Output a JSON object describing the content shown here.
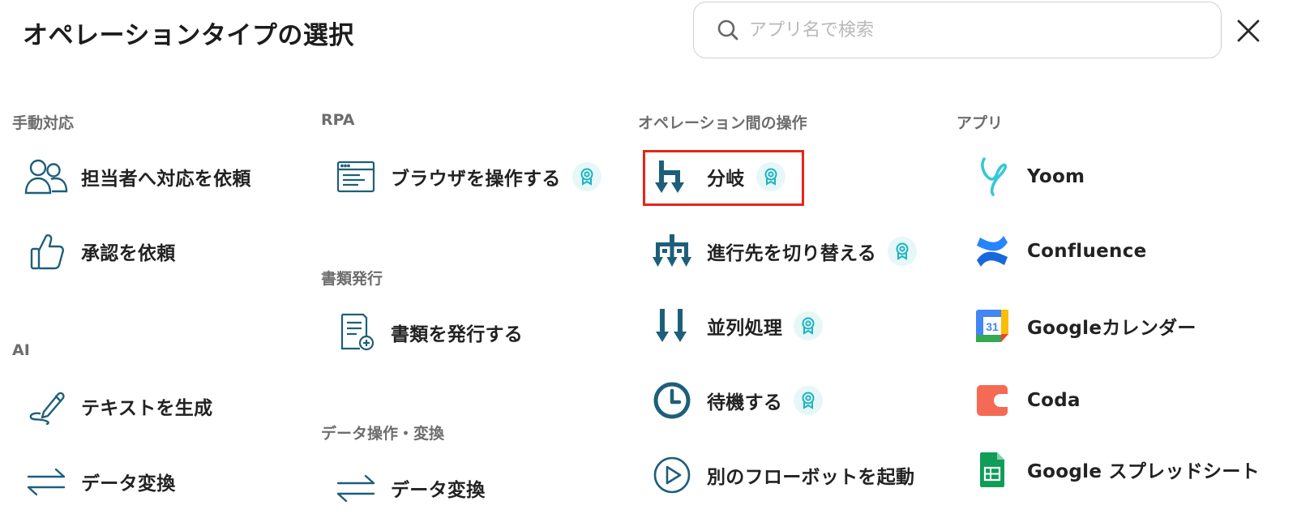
{
  "header": {
    "title": "オペレーションタイプの選択",
    "search_placeholder": "アプリ名で検索",
    "search_value": ""
  },
  "columns": {
    "manual": {
      "label": "手動対応",
      "items": [
        {
          "label": "担当者へ対応を依頼",
          "icon": "people-icon"
        },
        {
          "label": "承認を依頼",
          "icon": "thumbs-up-icon"
        }
      ]
    },
    "ai": {
      "label": "AI",
      "items": [
        {
          "label": "テキストを生成",
          "icon": "pen-icon"
        },
        {
          "label": "データ変換",
          "icon": "transform-arrows-icon"
        }
      ]
    },
    "rpa": {
      "label": "RPA",
      "items": [
        {
          "label": "ブラウザを操作する",
          "icon": "browser-icon",
          "badge": true
        }
      ]
    },
    "docs": {
      "label": "書類発行",
      "items": [
        {
          "label": "書類を発行する",
          "icon": "document-add-icon"
        }
      ]
    },
    "data_ops": {
      "label": "データ操作・変換",
      "items": [
        {
          "label": "データ変換",
          "icon": "transform-arrows-icon"
        }
      ]
    },
    "operations": {
      "label": "オペレーション間の操作",
      "items": [
        {
          "label": "分岐",
          "icon": "branch-icon",
          "badge": true,
          "selected": true
        },
        {
          "label": "進行先を切り替える",
          "icon": "switch-route-icon",
          "badge": true
        },
        {
          "label": "並列処理",
          "icon": "parallel-icon",
          "badge": true
        },
        {
          "label": "待機する",
          "icon": "clock-icon",
          "badge": true
        },
        {
          "label": "別のフローボットを起動",
          "icon": "play-circle-icon"
        }
      ]
    },
    "apps": {
      "label": "アプリ",
      "items": [
        {
          "label": "Yoom",
          "icon": "yoom-logo-icon"
        },
        {
          "label": "Confluence",
          "icon": "confluence-logo-icon"
        },
        {
          "label": "Googleカレンダー",
          "icon": "google-calendar-icon",
          "icon_text": "31"
        },
        {
          "label": "Coda",
          "icon": "coda-logo-icon"
        },
        {
          "label": "Google スプレッドシート",
          "icon": "google-sheets-icon"
        }
      ]
    }
  },
  "colors": {
    "icon_teal": "#1d5f7a",
    "badge_bg": "#e6f7f7",
    "badge_fg": "#19b3c3",
    "highlight": "#e3261c"
  }
}
